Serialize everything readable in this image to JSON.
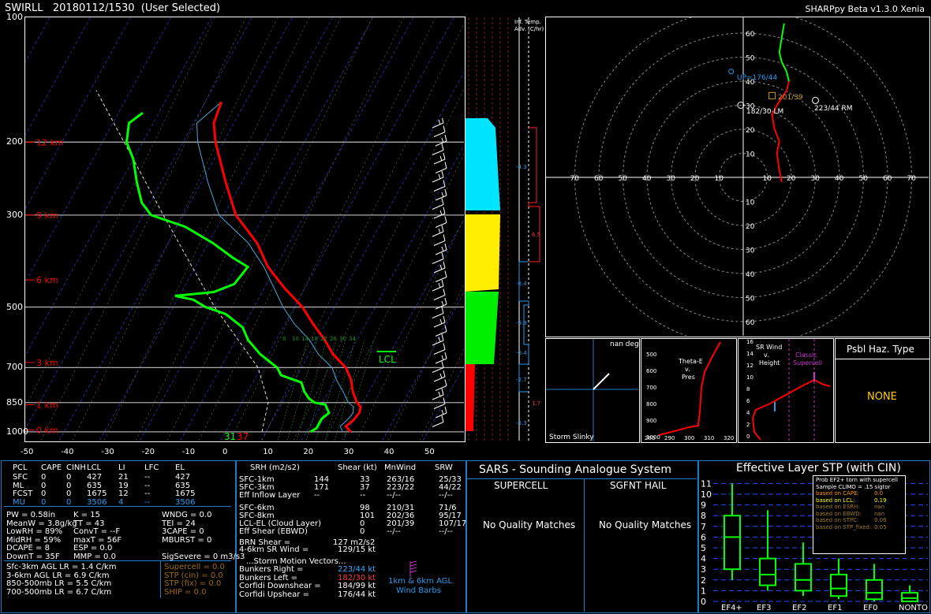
{
  "header": {
    "station": "SWIRLL",
    "datetime": "20180112/1530",
    "selection": "(User Selected)",
    "version": "SHARPpy Beta v1.3.0 Xenia"
  },
  "colors": {
    "temp": "#ff0000",
    "dewp": "#00ff00",
    "wetbulb": "#00ffff",
    "grid": "#ffffff",
    "panel_border": "#1f7bc4",
    "lcl": "#00ff00",
    "bunkers_left": "#ff3b3b",
    "bunkers_right": "#3aa8ff",
    "cape": "#d4a52b"
  },
  "chart_data": [
    {
      "type": "line",
      "name": "skewt",
      "ylabel_ticks": [
        "100",
        "200",
        "300",
        "500",
        "700",
        "850",
        "1000"
      ],
      "xticks": [
        "-50",
        "-40",
        "-30",
        "-20",
        "-10",
        "0",
        "10",
        "20",
        "30",
        "40",
        "50"
      ],
      "height_labels": [
        {
          "p": 200,
          "label": "12 km"
        },
        {
          "p": 300,
          "label": "9 km"
        },
        {
          "p": 430,
          "label": "6 km"
        },
        {
          "p": 680,
          "label": "3 km"
        },
        {
          "p": 860,
          "label": "1 km"
        },
        {
          "p": 990,
          "label": "0 km"
        }
      ],
      "isobars": [
        200,
        300,
        500,
        700,
        850,
        1000
      ],
      "temp_profile": [
        [
          1000,
          31
        ],
        [
          970,
          29
        ],
        [
          940,
          30
        ],
        [
          900,
          30.5
        ],
        [
          870,
          30
        ],
        [
          850,
          28.5
        ],
        [
          800,
          26
        ],
        [
          750,
          24
        ],
        [
          700,
          21
        ],
        [
          650,
          16
        ],
        [
          600,
          12
        ],
        [
          550,
          7
        ],
        [
          500,
          2
        ],
        [
          450,
          -5
        ],
        [
          400,
          -12
        ],
        [
          350,
          -18
        ],
        [
          300,
          -27
        ],
        [
          250,
          -34
        ],
        [
          200,
          -42
        ],
        [
          180,
          -45
        ],
        [
          160,
          -46
        ]
      ],
      "dewp_profile": [
        [
          1000,
          21
        ],
        [
          980,
          22
        ],
        [
          960,
          22
        ],
        [
          930,
          22
        ],
        [
          900,
          23
        ],
        [
          880,
          22
        ],
        [
          860,
          21
        ],
        [
          850,
          18
        ],
        [
          830,
          16
        ],
        [
          800,
          14
        ],
        [
          760,
          12
        ],
        [
          730,
          6
        ],
        [
          700,
          4
        ],
        [
          650,
          -2
        ],
        [
          600,
          -7
        ],
        [
          560,
          -10
        ],
        [
          520,
          -16
        ],
        [
          500,
          -22
        ],
        [
          480,
          -26
        ],
        [
          470,
          -31
        ],
        [
          460,
          -22
        ],
        [
          440,
          -18
        ],
        [
          400,
          -17
        ],
        [
          380,
          -22
        ],
        [
          350,
          -29
        ],
        [
          320,
          -38
        ],
        [
          300,
          -48
        ],
        [
          280,
          -52
        ],
        [
          250,
          -56
        ],
        [
          220,
          -60
        ],
        [
          200,
          -64
        ],
        [
          180,
          -66
        ],
        [
          170,
          -64
        ]
      ],
      "surface_temp_label": "37",
      "surface_dewp_label": "31",
      "lcl_label": "LCL",
      "mixing_ratio_labels": [
        "6",
        "10",
        "14",
        "18",
        "22",
        "26",
        "30",
        "34"
      ]
    },
    {
      "type": "scatter",
      "name": "hodograph",
      "rings": [
        10,
        20,
        30,
        40,
        50,
        60,
        70
      ],
      "axis_labels_x": [
        "70",
        "60",
        "50",
        "40",
        "30",
        "20",
        "10",
        "",
        "10",
        "20",
        "30",
        "40",
        "50",
        "60",
        "70"
      ],
      "axis_labels_y": [
        "60",
        "50",
        "40",
        "30",
        "20",
        "10",
        "",
        "10",
        "20",
        "30",
        "40",
        "50",
        "60"
      ],
      "trace": [
        [
          16,
          -2
        ],
        [
          15,
          3
        ],
        [
          14,
          10
        ],
        [
          15,
          15
        ],
        [
          13,
          20
        ],
        [
          12,
          26
        ],
        [
          14,
          30
        ],
        [
          16,
          33
        ],
        [
          18,
          36
        ],
        [
          19,
          40
        ],
        [
          18,
          44
        ],
        [
          16,
          48
        ],
        [
          15,
          52
        ],
        [
          16,
          58
        ],
        [
          17,
          64
        ]
      ],
      "rm_label": "223/44 RM",
      "lm_label": "182/30 LM",
      "mean_label": "201/39",
      "upshear_label": "UP=176/44"
    },
    {
      "type": "bar",
      "name": "effective_stp",
      "title": "Effective Layer STP (with CIN)",
      "categories": [
        "EF4+",
        "EF3",
        "EF2",
        "EF1",
        "EF0",
        "NONTOR"
      ],
      "boxes": [
        {
          "min": 2,
          "q1": 3,
          "med": 6,
          "q3": 8,
          "max": 11
        },
        {
          "min": 1,
          "q1": 1.5,
          "med": 2.5,
          "q3": 4,
          "max": 8.5
        },
        {
          "min": 0.5,
          "q1": 1,
          "med": 2,
          "q3": 3.5,
          "max": 5.5
        },
        {
          "min": 0.2,
          "q1": 0.5,
          "med": 1.2,
          "q3": 2.5,
          "max": 4
        },
        {
          "min": 0,
          "q1": 0.2,
          "med": 0.8,
          "q3": 2,
          "max": 3.5
        },
        {
          "min": 0,
          "q1": 0,
          "med": 0.3,
          "q3": 0.8,
          "max": 1.5
        }
      ],
      "yticks": [
        "0",
        "1",
        "2",
        "3",
        "4",
        "5",
        "6",
        "7",
        "8",
        "9",
        "10",
        "11"
      ],
      "legend_lines": [
        {
          "label": "Prob EF2+ torn with supercell",
          "value": "",
          "color": "#ffffff"
        },
        {
          "label": "Sample CLIMO = .15 sigtor",
          "value": "",
          "color": "#ffffff"
        },
        {
          "label": "based on CAPE:",
          "value": "0.0",
          "color": "#ff9900"
        },
        {
          "label": "based on LCL:",
          "value": "0.19",
          "color": "#ffff00"
        },
        {
          "label": "based on ESRH:",
          "value": "nan",
          "color": "#a07a20"
        },
        {
          "label": "based on EBWD:",
          "value": "nan",
          "color": "#a07a20"
        },
        {
          "label": "based on STPC:",
          "value": "0.06",
          "color": "#a07a20"
        },
        {
          "label": "based on STP_fixed:",
          "value": "0.05",
          "color": "#a07a20"
        }
      ]
    }
  ],
  "thetae": {
    "label1": "Theta-E",
    "label2": "v.",
    "label3": "Pres",
    "yticks": [
      "500",
      "600",
      "700",
      "800",
      "900",
      "1000"
    ],
    "xticks": [
      "280",
      "290",
      "300",
      "310",
      "320"
    ]
  },
  "slinky": {
    "title": "nan deg",
    "footer": "Storm Slinky"
  },
  "srwind": {
    "title1": "SR Wind",
    "title2": "v.",
    "title3": "Height",
    "classic1": "Classic",
    "classic2": "Supercell",
    "yticks": [
      "16",
      "14",
      "12",
      "10",
      "8",
      "6",
      "4",
      "2",
      "0"
    ]
  },
  "hazard": {
    "title": "Psbl Haz. Type",
    "value": "NONE"
  },
  "inftemp": {
    "title1": "Inf. Temp.",
    "title2": "Adv. (C/hr)",
    "values": [
      "-4.3",
      "6.5",
      "-8.4",
      "-9.9",
      "-0.4",
      "-2.7",
      "1.7",
      "-3.3"
    ]
  },
  "parcels": {
    "headers": [
      "PCL",
      "CAPE",
      "CINH",
      "LCL",
      "LI",
      "LFC",
      "EL"
    ],
    "rows": [
      [
        "SFC",
        "0",
        "0",
        "427",
        "21",
        "--",
        "427"
      ],
      [
        "ML",
        "0",
        "0",
        "635",
        "19",
        "--",
        "635"
      ],
      [
        "FCST",
        "0",
        "0",
        "1675",
        "12",
        "--",
        "1675"
      ],
      [
        "MU",
        "0",
        "0",
        "3506",
        "4",
        "--",
        "3506"
      ]
    ]
  },
  "indices": {
    "col1": [
      "PW = 0.58in",
      "MeanW = 3.8g/kg",
      "LowRH = 89%",
      "MidRH = 59%",
      "DCAPE = 8",
      "DownT = 35F"
    ],
    "col2": [
      "K = 15",
      "TT = 43",
      "ConvT = --F",
      "maxT = 56F",
      "ESP = 0.0",
      "MMP = 0.0"
    ],
    "col3": [
      "WNDG = 0.0",
      "TEI = 24",
      "3CAPE = 0",
      "MBURST = 0",
      "",
      "SigSevere = 0 m3/s3"
    ],
    "lapse": [
      "Sfc-3km AGL LR = 1.4 C/km",
      "3-6km AGL LR = 6.9 C/km",
      "850-500mb LR = 5.5 C/km",
      "700-500mb LR = 6.7 C/km"
    ],
    "composites": [
      "Supercell = 0.0",
      "STP (cin) = 0.0",
      "STP (fix) = 0.0",
      "SHIP = 0.0"
    ]
  },
  "kinematics": {
    "headers": [
      "SRH (m2/s2)",
      "Shear (kt)",
      "MnWind",
      "SRW"
    ],
    "rows": [
      [
        "SFC-1km",
        "144",
        "33",
        "263/16",
        "25/33"
      ],
      [
        "SFC-3km",
        "171",
        "37",
        "223/22",
        "44/22"
      ],
      [
        "Eff Inflow Layer",
        "--",
        "--",
        "--/--",
        "--/--"
      ],
      [
        "SFC-6km",
        "",
        "98",
        "210/31",
        "71/6"
      ],
      [
        "SFC-8km",
        "",
        "101",
        "202/36",
        "95/17"
      ],
      [
        "LCL-EL (Cloud Layer)",
        "",
        "0",
        "201/39",
        "107/17"
      ],
      [
        "Eff Shear (EBWD)",
        "",
        "0",
        "--/--",
        "--/--"
      ]
    ],
    "brn_label": "BRN Shear =",
    "brn_value": "127 m2/s2",
    "srwind_label": "4-6km SR Wind =",
    "srwind_value": "129/15 kt",
    "storm_motion_title": "...Storm Motion Vectors...",
    "motions": [
      [
        "Bunkers Right =",
        "223/44 kt"
      ],
      [
        "Bunkers Left =",
        "182/30 kt"
      ],
      [
        "Corfidi Downshear =",
        "184/99 kt"
      ],
      [
        "Corfidi Upshear =",
        "176/44 kt"
      ]
    ],
    "barb_label1": "1km & 6km AGL",
    "barb_label2": "Wind Barbs"
  },
  "sars": {
    "title": "SARS - Sounding Analogue System",
    "col1": "SUPERCELL",
    "col2": "SGFNT HAIL",
    "msg1": "No Quality Matches",
    "msg2": "No Quality Matches"
  }
}
